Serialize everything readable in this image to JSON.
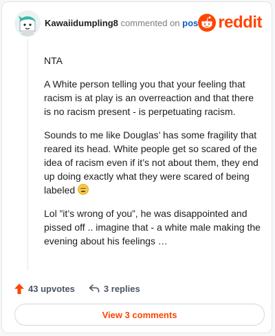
{
  "header": {
    "username": "Kawaiidumpling8",
    "action_text": "commented on",
    "post_link": "post",
    "brand": "reddit"
  },
  "comment": {
    "paragraphs": [
      "NTA",
      "A White person telling you that your feeling that racism is at play is an overreaction and that there is no racism present - is perpetuating racism.",
      "Sounds to me like Douglas’ has some fragility that reared its head. White people get so scared of the idea of racism even if it’s not about them, they end up doing exactly what they were scared of being labeled",
      "Lol ”it’s wrong of you”, he was disappointed and pissed off .. imagine that - a white male making the evening about his feelings …"
    ]
  },
  "actions": {
    "upvotes": "43 upvotes",
    "replies": "3 replies"
  },
  "view_comments": "View 3 comments",
  "colors": {
    "brand": "#ff4500",
    "link": "#0b5fbd"
  },
  "icons": {
    "avatar": "snoo-avatar",
    "brand_logo": "reddit-alien-icon",
    "upvote": "upvote-arrow-icon",
    "reply": "reply-arrow-icon",
    "emoji": "grimacing-face-emoji"
  }
}
